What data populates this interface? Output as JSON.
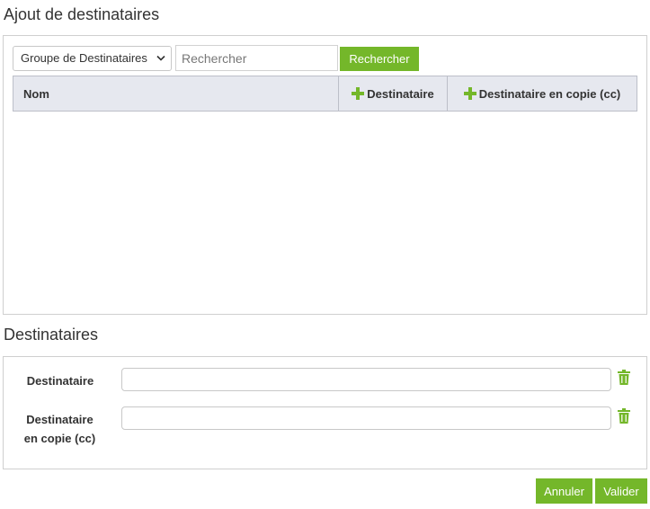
{
  "ajout": {
    "title": "Ajout de destinataires",
    "group_select": {
      "selected": "Groupe de Destinataires"
    },
    "search": {
      "placeholder": "Rechercher",
      "value": ""
    },
    "search_button_label": "Rechercher",
    "table": {
      "columns": {
        "nom": "Nom",
        "destinataire": "Destinataire",
        "copie": "Destinataire en copie (cc)"
      },
      "rows": []
    }
  },
  "destinataires": {
    "title": "Destinataires",
    "destinataire_label": "Destinataire",
    "copie_label_line1": "Destinataire",
    "copie_label_line2": "en copie (cc)",
    "destinataire_value": "",
    "copie_value": ""
  },
  "footer": {
    "annuler_label": "Annuler",
    "valider_label": "Valider"
  },
  "colors": {
    "accent": "#74b72a",
    "header_bg": "#e6e8ef"
  },
  "icons": {
    "add": "plus-icon",
    "delete": "trash-icon",
    "dropdown": "chevron-down-icon"
  }
}
